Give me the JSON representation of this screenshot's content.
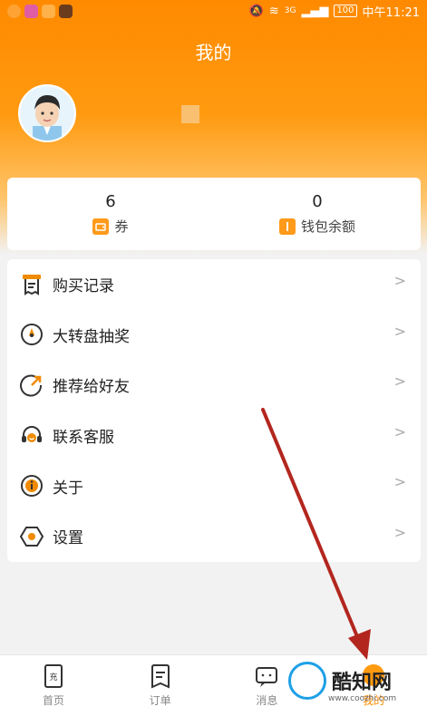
{
  "status_bar": {
    "time": "中午11:21",
    "battery": "100",
    "network": "3G"
  },
  "header": {
    "title": "我的"
  },
  "stats": [
    {
      "value": "6",
      "label": "券",
      "icon": "coupon-icon"
    },
    {
      "value": "0",
      "label": "钱包余额",
      "icon": "wallet-icon"
    }
  ],
  "menu": [
    {
      "label": "购买记录",
      "icon": "receipt-icon"
    },
    {
      "label": "大转盘抽奖",
      "icon": "wheel-icon"
    },
    {
      "label": "推荐给好友",
      "icon": "share-icon"
    },
    {
      "label": "联系客服",
      "icon": "headset-icon"
    },
    {
      "label": "关于",
      "icon": "info-icon"
    },
    {
      "label": "设置",
      "icon": "settings-icon"
    }
  ],
  "tabs": [
    {
      "label": "首页",
      "icon": "home-icon"
    },
    {
      "label": "订单",
      "icon": "order-icon"
    },
    {
      "label": "消息",
      "icon": "message-icon"
    },
    {
      "label": "我的",
      "icon": "profile-icon"
    }
  ],
  "watermark": {
    "text": "酷知网",
    "url": "www.coozhi.com"
  },
  "colors": {
    "accent": "#ff8a00",
    "arrow": "#b3261e"
  }
}
